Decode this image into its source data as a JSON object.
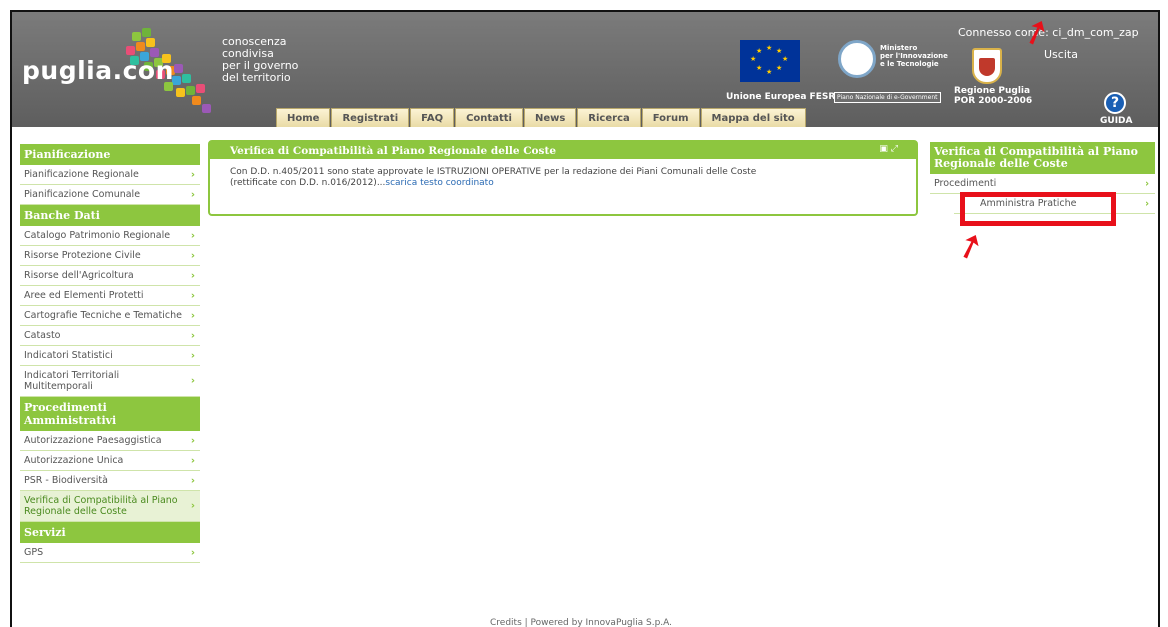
{
  "header": {
    "logo": "puglia.con",
    "tagline": [
      "conoscenza",
      "condivisa",
      "per il governo",
      "del territorio"
    ],
    "eu_label": "Unione Europea FESR",
    "ministry_label": [
      "Ministero",
      "per l'Innovazione",
      "e le Tecnologie"
    ],
    "pne_label": "Piano Nazionale di e-Government",
    "region_label": [
      "Regione Puglia",
      "POR 2000-2006"
    ],
    "connected_text": "Connesso come: ci_dm_com_zap",
    "exit_label": "Uscita",
    "help_label": "GUIDA"
  },
  "menu": [
    "Home",
    "Registrati",
    "FAQ",
    "Contatti",
    "News",
    "Ricerca",
    "Forum",
    "Mappa del sito"
  ],
  "sidebar": {
    "sections": [
      {
        "title": "Pianificazione",
        "items": [
          "Pianificazione Regionale",
          "Pianificazione Comunale"
        ]
      },
      {
        "title": "Banche Dati",
        "items": [
          "Catalogo Patrimonio Regionale",
          "Risorse Protezione Civile",
          "Risorse dell'Agricoltura",
          "Aree ed Elementi Protetti",
          "Cartografie Tecniche e Tematiche",
          "Catasto",
          "Indicatori Statistici",
          "Indicatori Territoriali Multitemporali"
        ]
      },
      {
        "title": "Procedimenti Amministrativi",
        "items": [
          "Autorizzazione Paesaggistica",
          "Autorizzazione Unica",
          "PSR - Biodiversità",
          "Verifica di Compatibilità al Piano Regionale delle Coste"
        ]
      },
      {
        "title": "Servizi",
        "items": [
          "GPS"
        ]
      }
    ]
  },
  "main": {
    "title": "Verifica di Compatibilità al Piano Regionale delle Coste",
    "text_line1": "Con D.D. n.405/2011 sono state approvate le ISTRUZIONI OPERATIVE per la redazione dei Piani Comunali delle Coste",
    "text_line2": "(rettificate con D.D. n.016/2012)...",
    "link": "scarica testo coordinato"
  },
  "right": {
    "title": "Verifica di Compatibilità al Piano Regionale delle Coste",
    "item": "Procedimenti",
    "subitem": "Amministra Pratiche"
  },
  "footer": "Credits | Powered by InnovaPuglia S.p.A.",
  "colors": {
    "accent_green": "#8dc63f",
    "header_gray": "#6a6a6a",
    "annotation_red": "#e8101a"
  }
}
